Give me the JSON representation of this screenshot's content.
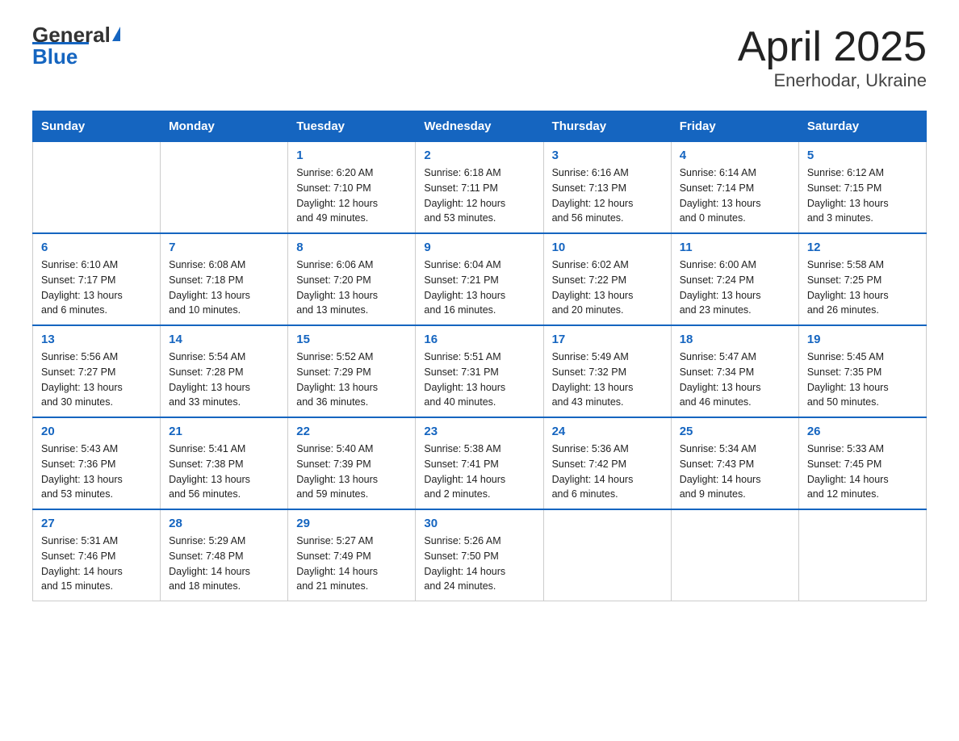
{
  "logo": {
    "text_general": "General",
    "text_blue": "Blue"
  },
  "title": "April 2025",
  "subtitle": "Enerhodar, Ukraine",
  "days_of_week": [
    "Sunday",
    "Monday",
    "Tuesday",
    "Wednesday",
    "Thursday",
    "Friday",
    "Saturday"
  ],
  "weeks": [
    [
      {
        "day": "",
        "info": ""
      },
      {
        "day": "",
        "info": ""
      },
      {
        "day": "1",
        "info": "Sunrise: 6:20 AM\nSunset: 7:10 PM\nDaylight: 12 hours\nand 49 minutes."
      },
      {
        "day": "2",
        "info": "Sunrise: 6:18 AM\nSunset: 7:11 PM\nDaylight: 12 hours\nand 53 minutes."
      },
      {
        "day": "3",
        "info": "Sunrise: 6:16 AM\nSunset: 7:13 PM\nDaylight: 12 hours\nand 56 minutes."
      },
      {
        "day": "4",
        "info": "Sunrise: 6:14 AM\nSunset: 7:14 PM\nDaylight: 13 hours\nand 0 minutes."
      },
      {
        "day": "5",
        "info": "Sunrise: 6:12 AM\nSunset: 7:15 PM\nDaylight: 13 hours\nand 3 minutes."
      }
    ],
    [
      {
        "day": "6",
        "info": "Sunrise: 6:10 AM\nSunset: 7:17 PM\nDaylight: 13 hours\nand 6 minutes."
      },
      {
        "day": "7",
        "info": "Sunrise: 6:08 AM\nSunset: 7:18 PM\nDaylight: 13 hours\nand 10 minutes."
      },
      {
        "day": "8",
        "info": "Sunrise: 6:06 AM\nSunset: 7:20 PM\nDaylight: 13 hours\nand 13 minutes."
      },
      {
        "day": "9",
        "info": "Sunrise: 6:04 AM\nSunset: 7:21 PM\nDaylight: 13 hours\nand 16 minutes."
      },
      {
        "day": "10",
        "info": "Sunrise: 6:02 AM\nSunset: 7:22 PM\nDaylight: 13 hours\nand 20 minutes."
      },
      {
        "day": "11",
        "info": "Sunrise: 6:00 AM\nSunset: 7:24 PM\nDaylight: 13 hours\nand 23 minutes."
      },
      {
        "day": "12",
        "info": "Sunrise: 5:58 AM\nSunset: 7:25 PM\nDaylight: 13 hours\nand 26 minutes."
      }
    ],
    [
      {
        "day": "13",
        "info": "Sunrise: 5:56 AM\nSunset: 7:27 PM\nDaylight: 13 hours\nand 30 minutes."
      },
      {
        "day": "14",
        "info": "Sunrise: 5:54 AM\nSunset: 7:28 PM\nDaylight: 13 hours\nand 33 minutes."
      },
      {
        "day": "15",
        "info": "Sunrise: 5:52 AM\nSunset: 7:29 PM\nDaylight: 13 hours\nand 36 minutes."
      },
      {
        "day": "16",
        "info": "Sunrise: 5:51 AM\nSunset: 7:31 PM\nDaylight: 13 hours\nand 40 minutes."
      },
      {
        "day": "17",
        "info": "Sunrise: 5:49 AM\nSunset: 7:32 PM\nDaylight: 13 hours\nand 43 minutes."
      },
      {
        "day": "18",
        "info": "Sunrise: 5:47 AM\nSunset: 7:34 PM\nDaylight: 13 hours\nand 46 minutes."
      },
      {
        "day": "19",
        "info": "Sunrise: 5:45 AM\nSunset: 7:35 PM\nDaylight: 13 hours\nand 50 minutes."
      }
    ],
    [
      {
        "day": "20",
        "info": "Sunrise: 5:43 AM\nSunset: 7:36 PM\nDaylight: 13 hours\nand 53 minutes."
      },
      {
        "day": "21",
        "info": "Sunrise: 5:41 AM\nSunset: 7:38 PM\nDaylight: 13 hours\nand 56 minutes."
      },
      {
        "day": "22",
        "info": "Sunrise: 5:40 AM\nSunset: 7:39 PM\nDaylight: 13 hours\nand 59 minutes."
      },
      {
        "day": "23",
        "info": "Sunrise: 5:38 AM\nSunset: 7:41 PM\nDaylight: 14 hours\nand 2 minutes."
      },
      {
        "day": "24",
        "info": "Sunrise: 5:36 AM\nSunset: 7:42 PM\nDaylight: 14 hours\nand 6 minutes."
      },
      {
        "day": "25",
        "info": "Sunrise: 5:34 AM\nSunset: 7:43 PM\nDaylight: 14 hours\nand 9 minutes."
      },
      {
        "day": "26",
        "info": "Sunrise: 5:33 AM\nSunset: 7:45 PM\nDaylight: 14 hours\nand 12 minutes."
      }
    ],
    [
      {
        "day": "27",
        "info": "Sunrise: 5:31 AM\nSunset: 7:46 PM\nDaylight: 14 hours\nand 15 minutes."
      },
      {
        "day": "28",
        "info": "Sunrise: 5:29 AM\nSunset: 7:48 PM\nDaylight: 14 hours\nand 18 minutes."
      },
      {
        "day": "29",
        "info": "Sunrise: 5:27 AM\nSunset: 7:49 PM\nDaylight: 14 hours\nand 21 minutes."
      },
      {
        "day": "30",
        "info": "Sunrise: 5:26 AM\nSunset: 7:50 PM\nDaylight: 14 hours\nand 24 minutes."
      },
      {
        "day": "",
        "info": ""
      },
      {
        "day": "",
        "info": ""
      },
      {
        "day": "",
        "info": ""
      }
    ]
  ]
}
